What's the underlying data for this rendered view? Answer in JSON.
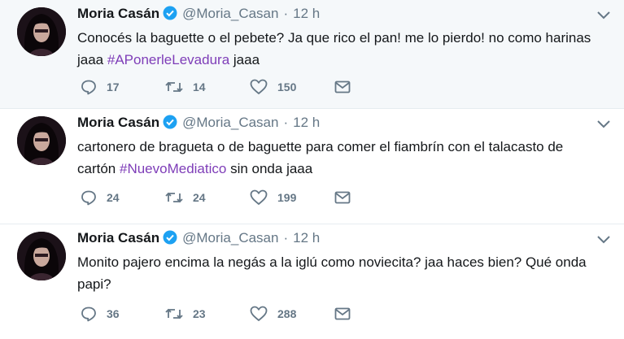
{
  "author": {
    "name": "Moria Casán",
    "handle": "@Moria_Casan"
  },
  "icons": {
    "reply": "reply-icon",
    "retweet": "retweet-icon",
    "like": "heart-icon",
    "dm": "direct-message-icon",
    "more": "chevron-down-icon",
    "verified": "verified-badge-icon"
  },
  "colors": {
    "hashtag": "#7e3db8",
    "verified": "#1da1f2",
    "muted": "#657786"
  },
  "tweets": [
    {
      "time": "12 h",
      "text_before": "Conocés la baguette o el pebete? Ja que rico el pan! me lo pierdo! no como harinas jaaa ",
      "hashtag": "#APonerleLevadura",
      "text_after": " jaaa",
      "replies": "17",
      "retweets": "14",
      "likes": "150"
    },
    {
      "time": "12 h",
      "text_before": "cartonero de bragueta o de baguette para comer el fiambrín con el talacasto de cartón ",
      "hashtag": "#NuevoMediatico",
      "text_after": " sin onda jaaa",
      "replies": "24",
      "retweets": "24",
      "likes": "199"
    },
    {
      "time": "12 h",
      "text_before": "Monito pajero encima la negás a la iglú como noviecita? jaa haces bien? Qué onda papi?",
      "hashtag": "",
      "text_after": "",
      "replies": "36",
      "retweets": "23",
      "likes": "288"
    }
  ]
}
